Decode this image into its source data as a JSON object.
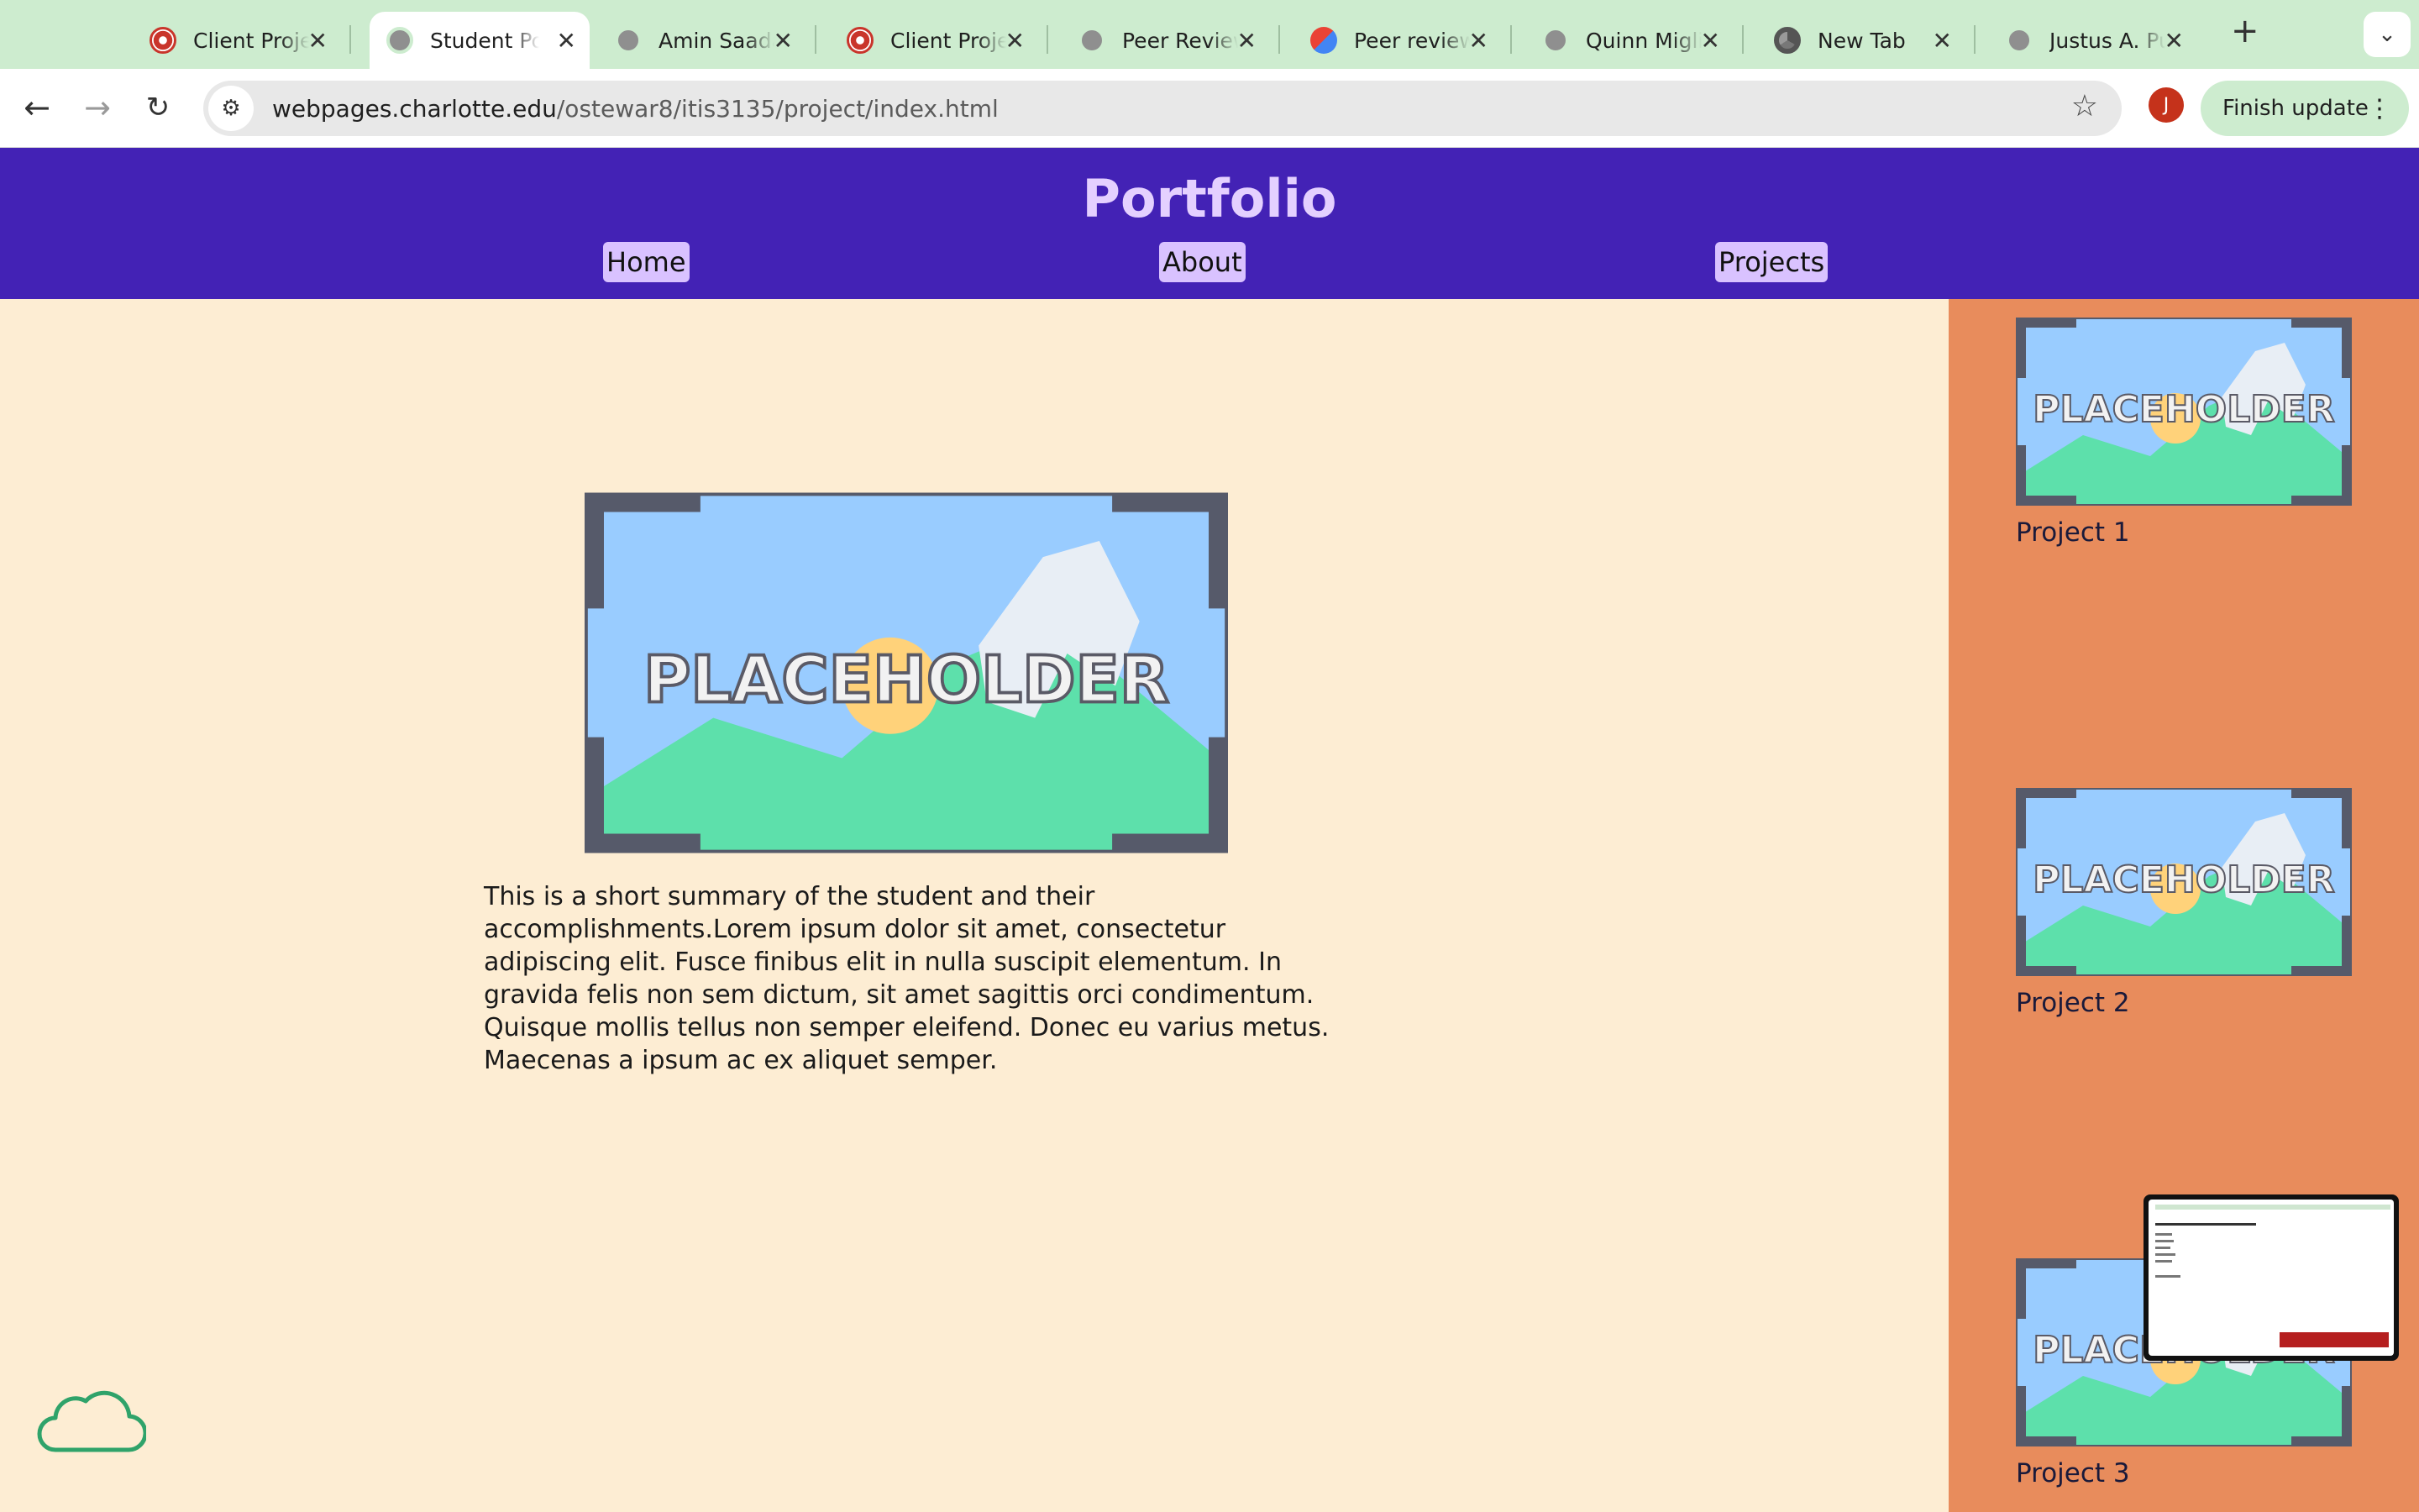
{
  "browser": {
    "tabs": [
      {
        "title": "Client Project",
        "icon": "ucf-icon"
      },
      {
        "title": "Student Portfolio",
        "icon": "globe-icon",
        "active": true
      },
      {
        "title": "Amin Saadat",
        "icon": "globe-icon"
      },
      {
        "title": "Client Project",
        "icon": "ucf-icon"
      },
      {
        "title": "Peer Review",
        "icon": "globe-icon"
      },
      {
        "title": "Peer review",
        "icon": "gmail-icon"
      },
      {
        "title": "Quinn Miglia",
        "icon": "globe-icon"
      },
      {
        "title": "New Tab",
        "icon": "chrome-icon"
      },
      {
        "title": "Justus A. Pu",
        "icon": "globe-icon"
      }
    ],
    "new_tab_symbol": "+",
    "tab_menu_symbol": "⌄",
    "url_domain": "webpages.charlotte.edu",
    "url_path": "/ostewar8/itis3135/project/index.html",
    "profile_initial": "J",
    "update_label": "Finish update"
  },
  "site": {
    "title": "Portfolio",
    "nav": [
      "Home",
      "About",
      "Projects"
    ],
    "placeholder_text": "PLACEHOLDER",
    "summary": "This is a short summary of the student and their accomplishments.Lorem ipsum dolor sit amet, consectetur adipiscing elit. Fusce finibus elit in nulla suscipit elementum. In gravida felis non sem dictum, sit amet sagittis orci condimentum. Quisque mollis tellus non semper eleifend. Donec eu varius metus. Maecenas a ipsum ac ex aliquet semper.",
    "projects": [
      "Project 1",
      "Project 2",
      "Project 3"
    ]
  },
  "colors": {
    "header": "#4322b5",
    "title": "#e4d0ff",
    "nav_bg": "#d9c2ff",
    "page_bg": "#fdedd3",
    "sidebar": "#e88c5c",
    "tabbar": "#cdeccf"
  }
}
